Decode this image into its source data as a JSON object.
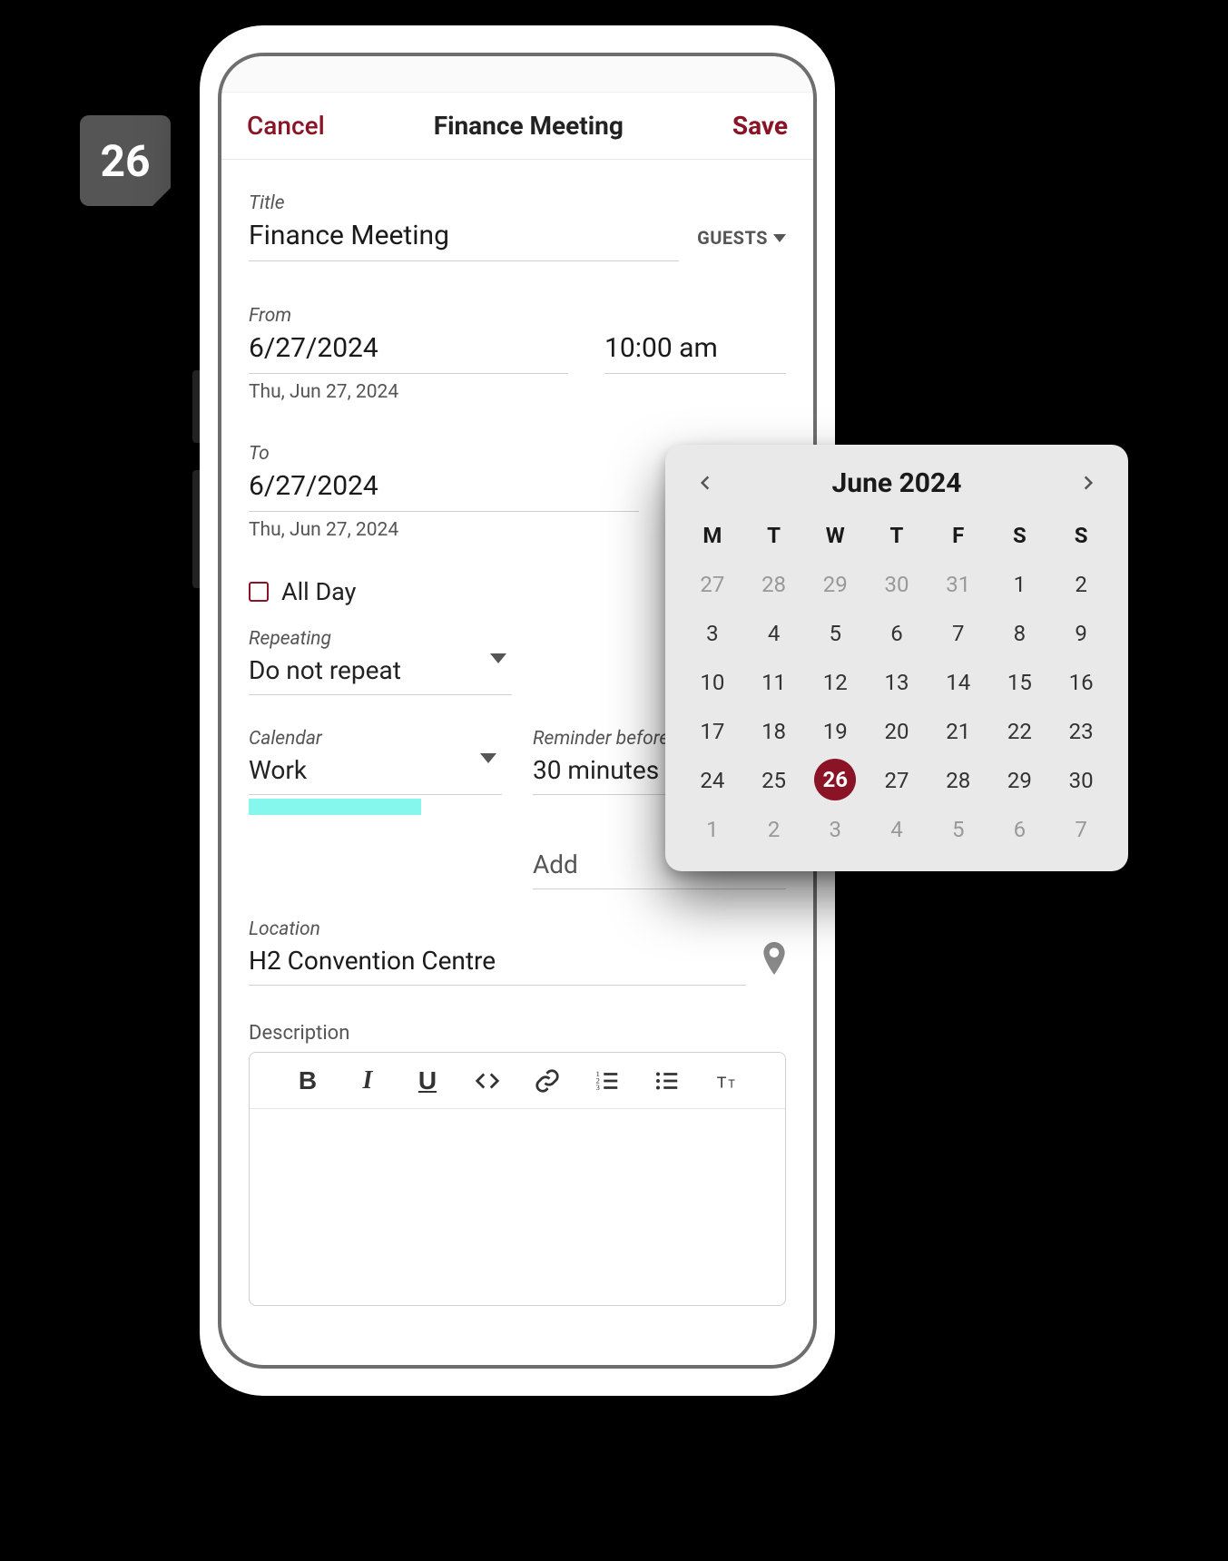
{
  "badge": {
    "day": "26"
  },
  "header": {
    "cancel": "Cancel",
    "title": "Finance Meeting",
    "save": "Save"
  },
  "form": {
    "title_label": "Title",
    "title_value": "Finance Meeting",
    "guests_label": "GUESTS",
    "from_label": "From",
    "from_date": "6/27/2024",
    "from_time": "10:00 am",
    "from_sub": "Thu, Jun 27, 2024",
    "to_label": "To",
    "to_date": "6/27/2024",
    "to_sub": "Thu, Jun 27, 2024",
    "allday_label": "All Day",
    "repeating_label": "Repeating",
    "repeating_value": "Do not repeat",
    "calendar_label": "Calendar",
    "calendar_value": "Work",
    "reminder_label": "Reminder before",
    "reminder_value": "30 minutes",
    "add_placeholder": "Add",
    "location_label": "Location",
    "location_value": "H2 Convention Centre",
    "description_label": "Description"
  },
  "datepicker": {
    "title": "June 2024",
    "dow": [
      "M",
      "T",
      "W",
      "T",
      "F",
      "S",
      "S"
    ],
    "weeks": [
      [
        {
          "d": "27",
          "other": true
        },
        {
          "d": "28",
          "other": true
        },
        {
          "d": "29",
          "other": true
        },
        {
          "d": "30",
          "other": true
        },
        {
          "d": "31",
          "other": true
        },
        {
          "d": "1"
        },
        {
          "d": "2"
        }
      ],
      [
        {
          "d": "3"
        },
        {
          "d": "4"
        },
        {
          "d": "5"
        },
        {
          "d": "6"
        },
        {
          "d": "7"
        },
        {
          "d": "8"
        },
        {
          "d": "9"
        }
      ],
      [
        {
          "d": "10"
        },
        {
          "d": "11"
        },
        {
          "d": "12"
        },
        {
          "d": "13"
        },
        {
          "d": "14"
        },
        {
          "d": "15"
        },
        {
          "d": "16"
        }
      ],
      [
        {
          "d": "17"
        },
        {
          "d": "18"
        },
        {
          "d": "19"
        },
        {
          "d": "20"
        },
        {
          "d": "21"
        },
        {
          "d": "22"
        },
        {
          "d": "23"
        }
      ],
      [
        {
          "d": "24"
        },
        {
          "d": "25"
        },
        {
          "d": "26",
          "selected": true
        },
        {
          "d": "27"
        },
        {
          "d": "28"
        },
        {
          "d": "29"
        },
        {
          "d": "30"
        }
      ],
      [
        {
          "d": "1",
          "other": true
        },
        {
          "d": "2",
          "other": true
        },
        {
          "d": "3",
          "other": true
        },
        {
          "d": "4",
          "other": true
        },
        {
          "d": "5",
          "other": true
        },
        {
          "d": "6",
          "other": true
        },
        {
          "d": "7",
          "other": true
        }
      ]
    ]
  }
}
